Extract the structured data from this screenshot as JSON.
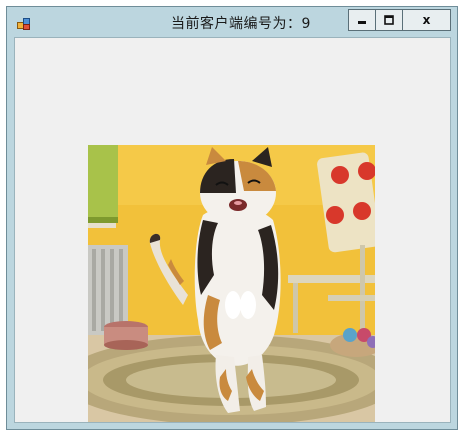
{
  "window": {
    "title": "当前客户端编号为：9",
    "controls": {
      "minimize_icon": "minimize-icon",
      "maximize_icon": "maximize-icon",
      "close_label": "x"
    }
  },
  "client": {
    "image": {
      "subject": "calico-cat-standing-on-hind-legs"
    }
  },
  "colors": {
    "frame": "#bcd6df",
    "client_bg": "#f0f0f0",
    "wall_yellow": "#f2c13a",
    "chair_cream": "#ede3c4",
    "dot_red": "#d8382b"
  }
}
